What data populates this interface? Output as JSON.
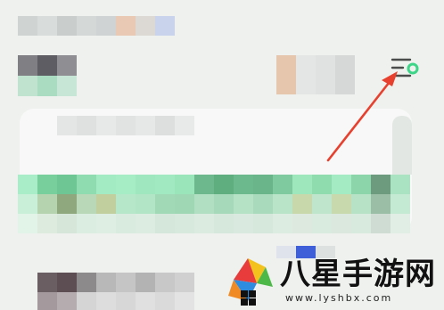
{
  "colors": {
    "background": "#eef1ee",
    "accent_green": "#3dd689",
    "arrow_red": "#e8402e"
  },
  "header": {
    "menu_icon": "menu-lines-with-green-dot-icon"
  },
  "annotation": {
    "arrow_icon": "red-arrow-pointer-icon"
  },
  "watermark": {
    "logo_icon": "colorful-leaf-logo-icon",
    "title": "八星手游网",
    "url": "www.lyshbx.com"
  }
}
